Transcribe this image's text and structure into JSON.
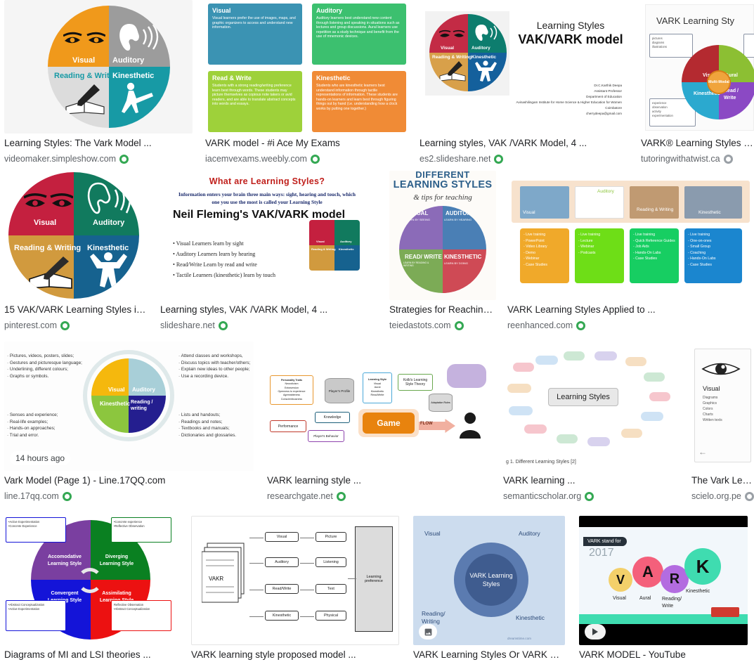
{
  "page": {
    "type": "image-search-results",
    "query_topic": "VARK learning styles",
    "columns": 4,
    "rows": 4
  },
  "icons": {
    "source_ring": "circle-ring-icon",
    "play": "play-icon",
    "image": "image-badge-icon"
  },
  "colors": {
    "title": "#202124",
    "source": "#5f6368",
    "ring_green": "#34a853",
    "ring_gray": "#9aa0a6",
    "thumb_bg": "#f1f3f4"
  },
  "results": [
    {
      "title": "Learning Styles: The Vark Model ...",
      "source": "videomaker.simpleshow.com",
      "ring": "green",
      "badge": null,
      "art": "vark-wheel-orange-gray"
    },
    {
      "title": "VARK model - #i Ace My Exams",
      "source": "iacemvexams.weebly.com",
      "ring": "green",
      "badge": null,
      "art": "four-colored-cards",
      "cards": [
        {
          "heading": "Visual",
          "color": "#3b93b3",
          "body": "Visual learners prefer the use of images, maps, and graphic organizers to access and understand new information."
        },
        {
          "heading": "Auditory",
          "color": "#3cc06f",
          "body": "Auditory learners best understand new content through listening and speaking in situations such as lectures and group discussions. Aural learners use repetition as a study technique and benefit from the use of mnemonic devices."
        },
        {
          "heading": "Read & Write",
          "color": "#9ed13a",
          "body": "Students with a strong reading/writing preference learn best through words. These students may picture themselves as copious note takers or avid readers, and are able to translate abstract concepts into words and essays."
        },
        {
          "heading": "Kinesthetic",
          "color": "#f08b36",
          "body": "Students who are kinesthetic learners best understand information through tactile representations of information. These students are hands-on learners and learn best through figuring things out by hand (i.e. understanding how a clock works by putting one together.)"
        }
      ]
    },
    {
      "title": "Learning styles, VAK /VARK Model, 4 ...",
      "source": "es2.slideshare.net",
      "ring": "green",
      "badge": null,
      "art": "slide-vak-vark",
      "slide": {
        "line1": "Learning Styles",
        "line2": "VAK/VARK model",
        "author": [
          "Dr.C.Karthik Deepa",
          "Assistant Professor",
          "Department of Education",
          "Avinashilingam Institute for Home Science & Higher Education for Women",
          "Coimbatore",
          "cherrydeepa@gmail.com"
        ]
      }
    },
    {
      "title": "VARK® Learning Styles - Wit",
      "source": "tutoringwithatwist.ca",
      "ring": "gray",
      "badge": null,
      "art": "vark-multimodal-wheel",
      "slide": {
        "heading": "VARK Learning Sty",
        "bullets_left_top": [
          "pictures",
          "diagrams",
          "illustrations"
        ],
        "bullets_left_bottom": [
          "experience",
          "observation",
          "activity",
          "experimentation"
        ],
        "center": "Multi-Modal",
        "labels": [
          "Visual",
          "Aural",
          "Kinesthetic",
          "Read / Write"
        ]
      }
    },
    {
      "title": "15 VAK/VARK Learning Styles ide…",
      "source": "pinterest.com",
      "ring": "green",
      "badge": null,
      "art": "vark-wheel-red-teal"
    },
    {
      "title": "Learning styles, VAK /VARK Model, 4 ...",
      "source": "slideshare.net",
      "ring": "green",
      "badge": null,
      "art": "neil-fleming-slide",
      "slide": {
        "heading": "What are Learning Styles?",
        "sub": "Information enters your brain three main ways: sight, hearing and touch, which one you use the most is called your Learning Style",
        "title2": "Neil Fleming's VAK/VARK model",
        "bullets": [
          "Visual Learners learn by sight",
          "Auditory Learners learn by hearing",
          "Read/Write Learn by read and write",
          "Tactile Learners (kinesthetic) learn by touch"
        ]
      }
    },
    {
      "title": "Strategies for Reaching…",
      "source": "teiedastots.com",
      "ring": "green",
      "badge": null,
      "art": "different-learning-styles-poster",
      "slide": {
        "top": "DIFFERENT",
        "heading": "LEARNING STYLES",
        "script": "& tips for teaching",
        "quadrants": [
          {
            "label": "VISUAL",
            "sub": "LEARN BY SEEING",
            "color": "#8b6bb8"
          },
          {
            "label": "AUDITORY",
            "sub": "LEARN BY HEARING",
            "color": "#4a7fb5"
          },
          {
            "label": "READ/ WRITE",
            "sub": "LEARN BY READING & WRITING",
            "color": "#7cab56"
          },
          {
            "label": "KINESTHETIC",
            "sub": "LEARN BY DOING",
            "color": "#cf4a55"
          }
        ]
      }
    },
    {
      "title": "VARK Learning Styles Applied to ...",
      "source": "reenhanced.com",
      "ring": "green",
      "badge": null,
      "art": "vark-photo-columns",
      "columns": [
        {
          "label": "Visual",
          "color": "#f0a92a",
          "items": [
            "- Live training",
            "- PowerPoint",
            "- Video Library",
            "- Demo",
            "- Webinar",
            "- Case Studies"
          ]
        },
        {
          "label": "Auditory",
          "color": "#6ede17",
          "items": [
            "- Live training",
            "- Lecture",
            "- Webinar",
            "- Podcasts"
          ]
        },
        {
          "label": "Reading & Writing",
          "color": "#17ce62",
          "items": [
            "- Live training",
            "- Quick Reference Guides",
            "- Job Aids",
            "- Hands-On Labs",
            "- Case Studies"
          ]
        },
        {
          "label": "Kinesthetic",
          "color": "#1b86cf",
          "items": [
            "- Live training",
            "- One-on-ones",
            "- Small Group",
            "- Coaching",
            "- Hands-On Labs",
            "- Case Studies"
          ]
        }
      ]
    },
    {
      "title": "Vark Model (Page 1) - Line.17QQ.com",
      "source": "line.17qq.com",
      "ring": "green",
      "badge": {
        "kind": "time",
        "label": "14 hours ago"
      },
      "art": "vark-circle-with-lists",
      "slide": {
        "left_top": [
          "Pictures, videos, posters, slides;",
          "Gestures and picturesque language;",
          "Underlining, different colours;",
          "Graphs or symbols."
        ],
        "left_bottom": [
          "Senses and experience;",
          "Real-life examples;",
          "Hands-on approaches;",
          "Trial and error."
        ],
        "right_top": [
          "Attend classes and workshops,",
          "Discuss topics with teacher/others;",
          "Explain new ideas to other people;",
          "Use a recording device."
        ],
        "right_bottom": [
          "Lists and handouts;",
          "Readings and notes;",
          "Textbooks and manuals;",
          "Dictionaries and glossaries."
        ],
        "quadrants": [
          "Visual",
          "Auditory",
          "Kinesthetic",
          "Reading / writing"
        ]
      }
    },
    {
      "title": "VARK learning style ...",
      "source": "researchgate.net",
      "ring": "green",
      "badge": null,
      "art": "game-flow-diagram",
      "diagram": {
        "nodes": [
          "Personality Traits",
          "Player's Profile",
          "Learning Style",
          "Kolb's Learning Style Theory",
          "Adaptation Rules",
          "Knowledge",
          "Game",
          "Performance",
          "Player's Behavior",
          "FLOW"
        ],
        "learning_style_items": [
          "Visual",
          "Aural",
          "Kinesthetic",
          "Read/Write"
        ],
        "personality_items": [
          "Neuroticism",
          "Extraversion",
          "Openness to experience",
          "Agreeableness",
          "Conscientiousness"
        ]
      }
    },
    {
      "title": "VARK learning ...",
      "source": "semanticscholar.org",
      "ring": "green",
      "badge": null,
      "art": "mindmap",
      "caption_in_image": "g 1. Different Learning Styles [2]",
      "center_label": "Learning Styles"
    },
    {
      "title": "The Vark Learni",
      "source": "scielo.org.pe",
      "ring": "gray",
      "badge": null,
      "art": "vark-card-eye",
      "slide": {
        "heading": "Visual",
        "items": [
          "Diagrams",
          "Graphics",
          "Colors",
          "Charts",
          "Written texts"
        ]
      }
    },
    {
      "title": "Diagrams of MI and LSI theories ...",
      "source": "",
      "ring": null,
      "badge": null,
      "art": "kolb-quadrant",
      "slide": {
        "quadrants": [
          {
            "label": "Accomodative Learning Style",
            "color": "#7a3fa0"
          },
          {
            "label": "Diverging Learning Style",
            "color": "#0a8021"
          },
          {
            "label": "Convergent Learning Style",
            "color": "#1414d8"
          },
          {
            "label": "Assimilating Learning Style",
            "color": "#ec1111"
          }
        ],
        "boxes": [
          [
            "Active Experimentation",
            "Concrete Experience"
          ],
          [
            "Concrete experience",
            "Reflective Observation"
          ],
          [
            "Abstract Conceptualization",
            "Active Experimentation"
          ],
          [
            "Reflective Observation",
            "Abstract Conceptualization"
          ]
        ]
      }
    },
    {
      "title": "VARK learning style proposed model ...",
      "source": "",
      "ring": null,
      "badge": null,
      "art": "flowchart-bw",
      "diagram": {
        "left": "VAKR",
        "middle": [
          "Visual",
          "Auditory",
          "Read/Write",
          "Kinesthetic"
        ],
        "right": [
          "Picture",
          "Listening",
          "Text",
          "Physical"
        ],
        "output": "Learning preference"
      }
    },
    {
      "title": "VARK Learning Styles Or VARK Mo…",
      "source": "",
      "ring": null,
      "badge": {
        "kind": "image",
        "label": "image-badge-icon"
      },
      "art": "vark-blue-circle",
      "slide": {
        "center": "VARK Learning Styles",
        "labels": [
          "Visual",
          "Auditory",
          "Reading/ Writing",
          "Kinesthetic"
        ],
        "watermark": "dreamstime.com"
      }
    },
    {
      "title": "VARK MODEL - YouTube",
      "source": "",
      "ring": null,
      "badge": {
        "kind": "play",
        "label": "play-icon"
      },
      "art": "vark-video",
      "slide": {
        "tag": "VARK stand for",
        "year": "2017",
        "letters": [
          "V",
          "A",
          "R",
          "K"
        ],
        "labels": [
          "Visual",
          "Aural",
          "Reading/ Write",
          "Kinesthetic"
        ]
      }
    }
  ]
}
